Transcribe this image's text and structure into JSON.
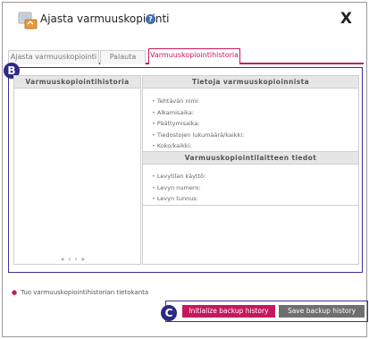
{
  "window": {
    "title": "Ajasta varmuuskopiointi",
    "close_label": "X",
    "help_label": "?"
  },
  "tabs": [
    {
      "label": "Ajasta varmuuskopiointi"
    },
    {
      "label": "Palauta"
    },
    {
      "label": "Varmuuskopiointihistoria",
      "active": true
    }
  ],
  "markers": {
    "b": "B",
    "c": "C"
  },
  "history_panel": {
    "header": "Varmuuskopiointihistoria",
    "pager": [
      "«",
      "‹",
      "›",
      "»"
    ]
  },
  "info_panel": {
    "header": "Tietoja varmuuskopioinnista",
    "items": [
      "Tehtävän nimi:",
      "Alkamisaika:",
      "Päättymisaika:",
      "Tiedostojen lukumäärä/kaikki:",
      "Koko/kaikki:"
    ],
    "device_header": "Varmuuskopiointilaitteen tiedot",
    "device_items": [
      "Levytilan käyttö:",
      "Levyn numero:",
      "Levyn tunnus:"
    ]
  },
  "import_link": "Tuo varmuuskopiointihistorian tietokanta",
  "buttons": {
    "initialize": "Initialize backup history",
    "save": "Save backup history"
  },
  "colors": {
    "accent": "#c5185c",
    "annotation": "#2d2a87",
    "save_button": "#6f6f6f"
  }
}
